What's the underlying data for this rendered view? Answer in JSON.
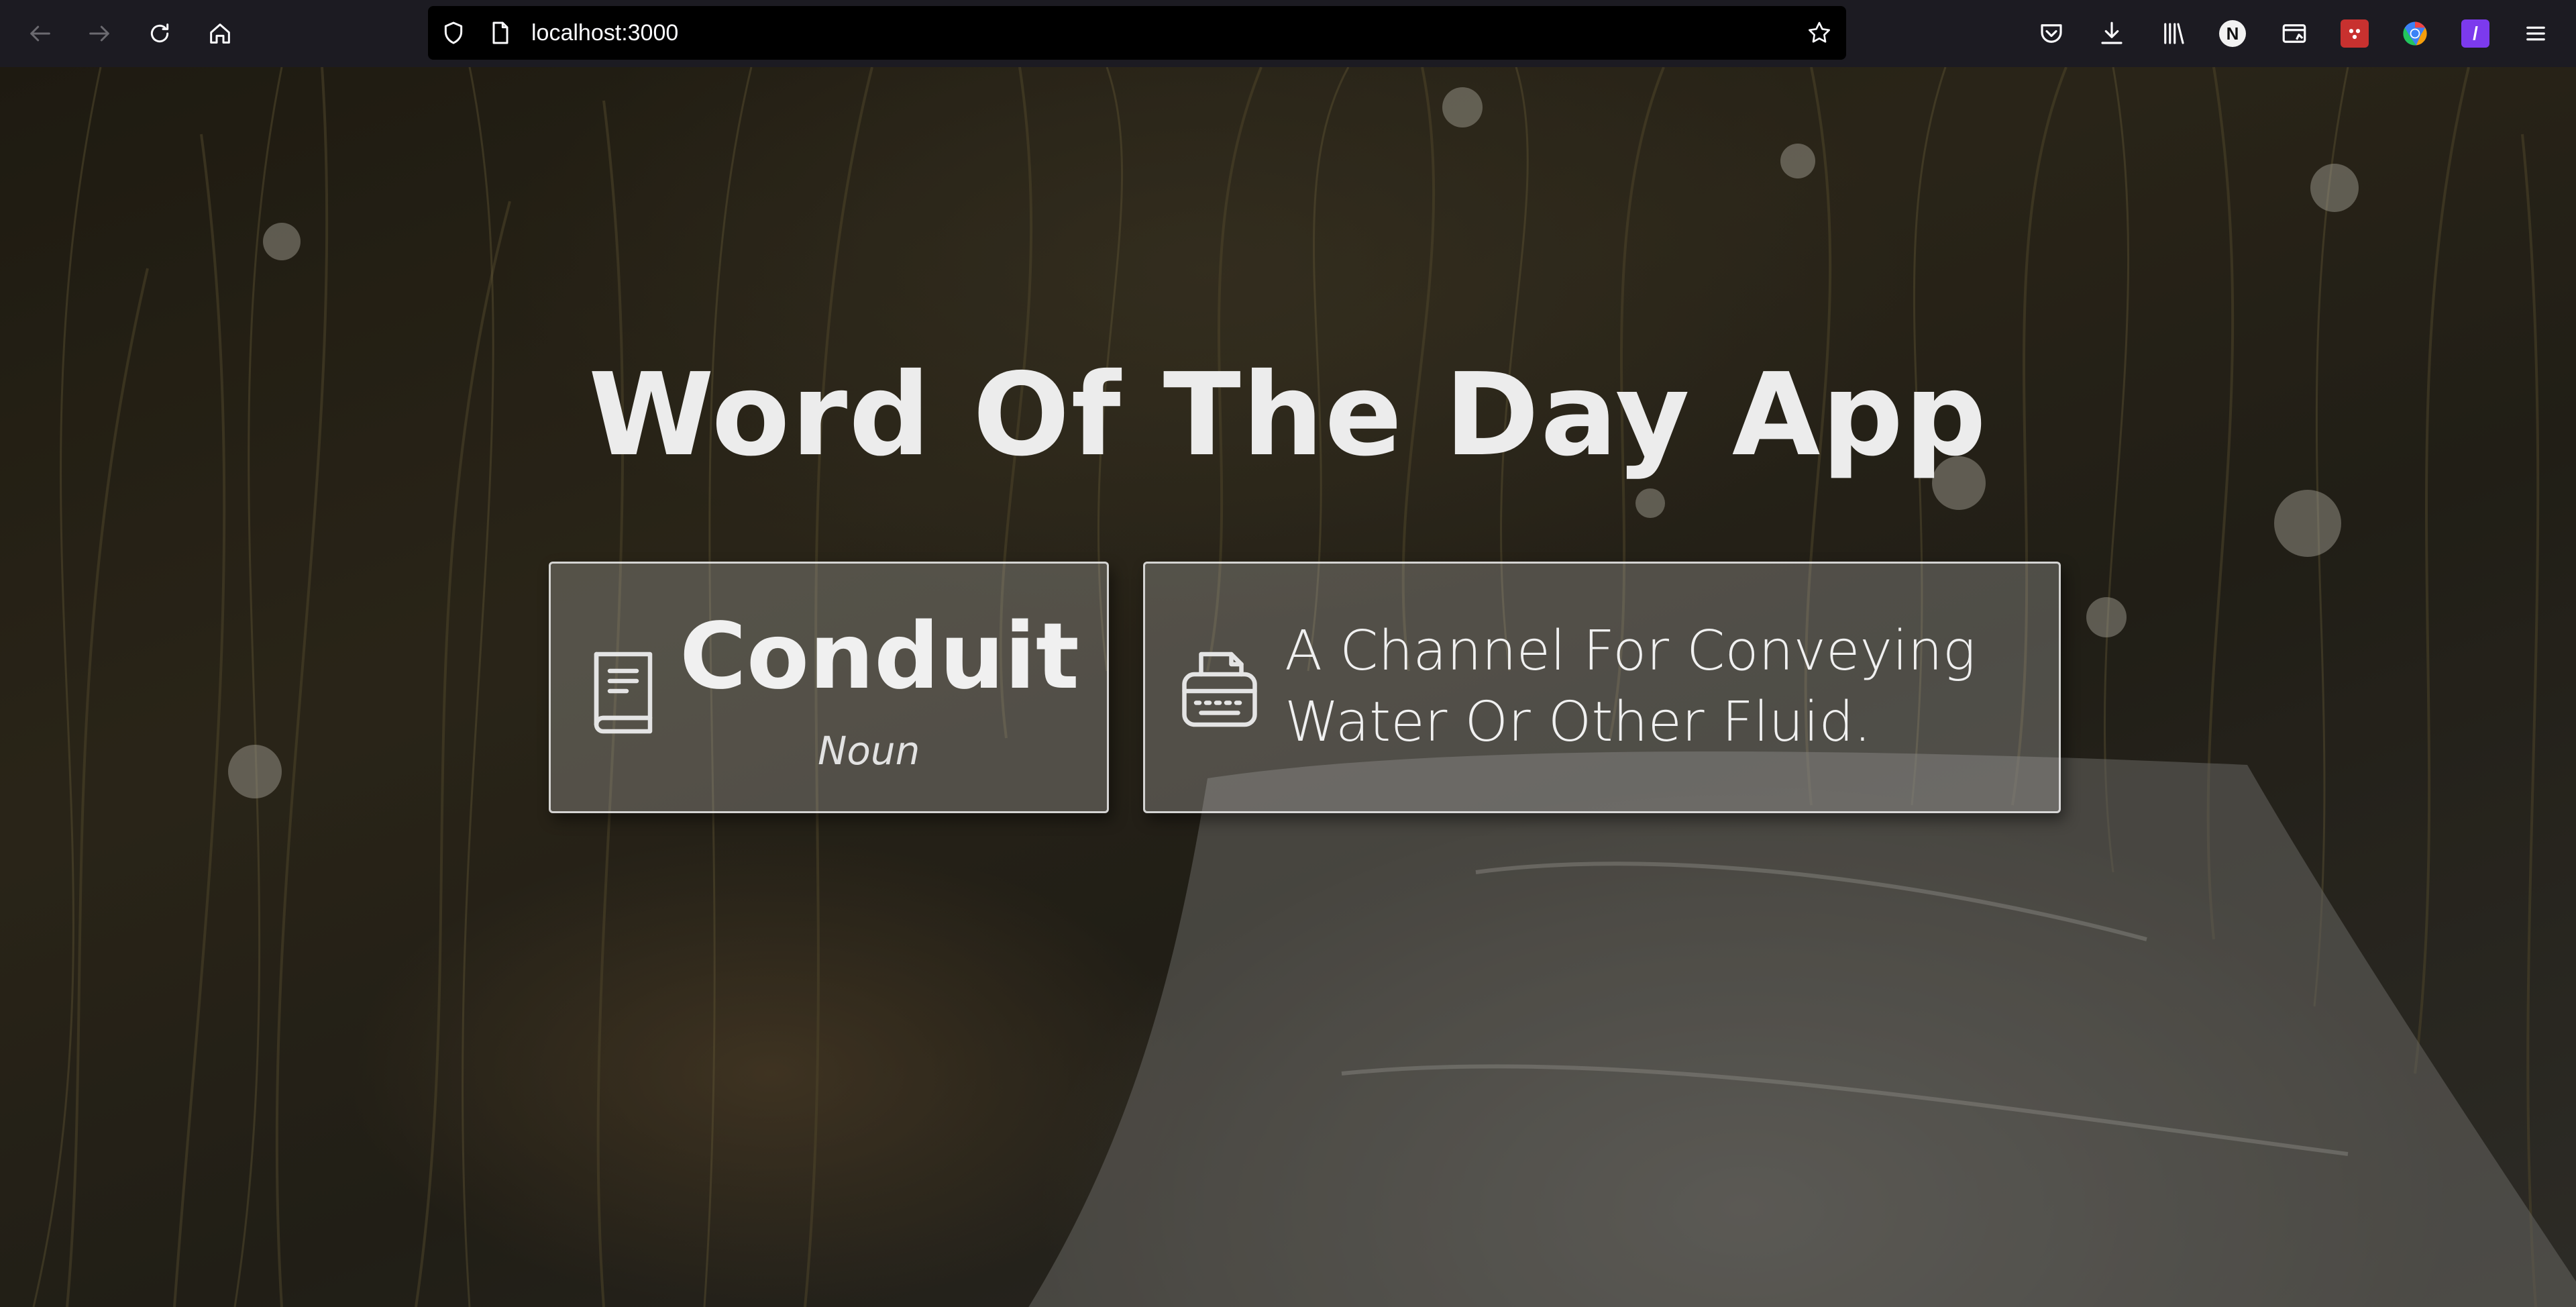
{
  "browser": {
    "url": "localhost:3000",
    "nav_icons": [
      "back-arrow-icon",
      "forward-arrow-icon",
      "reload-icon",
      "home-icon"
    ],
    "toolbar_icons": [
      "pocket-icon",
      "downloads-icon",
      "library-icon",
      "extension-n-icon",
      "reader-extension-icon",
      "red-extension-icon",
      "chrome-like-extension-icon",
      "purple-extension-icon",
      "hamburger-menu-icon"
    ],
    "extension_n_label": "N",
    "extension_purple_label": "/",
    "colors": {
      "toolbar_bg": "#1c1b22",
      "urlbar_bg": "#000000",
      "icon": "#fbfbfe"
    }
  },
  "app": {
    "title": "Word Of The Day App",
    "word": "Conduit",
    "part_of_speech": "Noun",
    "definition": "A Channel For Conveying Water Or Other Fluid.",
    "word_icon": "book-icon",
    "definition_icon": "typewriter-icon",
    "colors": {
      "title": "#ececec",
      "card_border": "#ebebeb",
      "text": "#f0f0f0"
    }
  }
}
